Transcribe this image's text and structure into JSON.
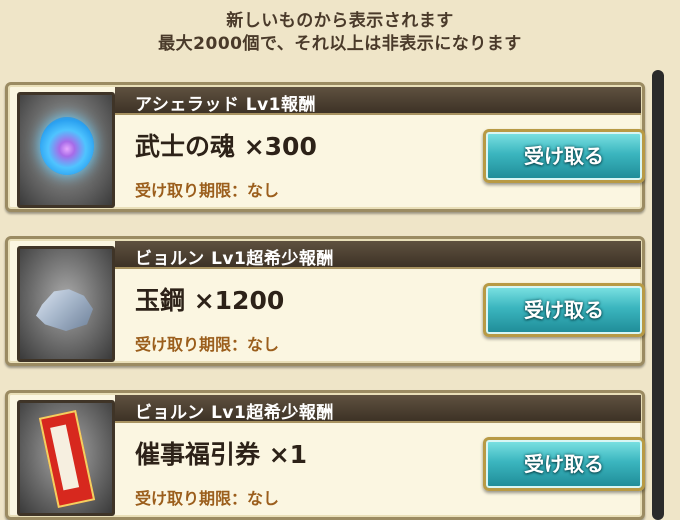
{
  "notice": {
    "line1": "新しいものから表示されます",
    "line2": "最大2000個で、それ以上は非表示になります"
  },
  "rewards": [
    {
      "title": "アシェラッド Lv1報酬",
      "item": "武士の魂 ×300",
      "expiry": "受け取り期限：なし",
      "button": "受け取る",
      "icon": "blue-soul-orb-icon"
    },
    {
      "title": "ビョルン Lv1超希少報酬",
      "item": "玉鋼 ×1200",
      "expiry": "受け取り期限：なし",
      "button": "受け取る",
      "icon": "steel-ore-icon"
    },
    {
      "title": "ビョルン Lv1超希少報酬",
      "item": "催事福引券 ×1",
      "expiry": "受け取り期限：なし",
      "button": "受け取る",
      "icon": "lottery-ticket-icon"
    }
  ],
  "colors": {
    "button": "#3bb6bf",
    "header": "#4a3d2f",
    "expiry": "#9b5e1c",
    "card": "#fbf6e1"
  }
}
